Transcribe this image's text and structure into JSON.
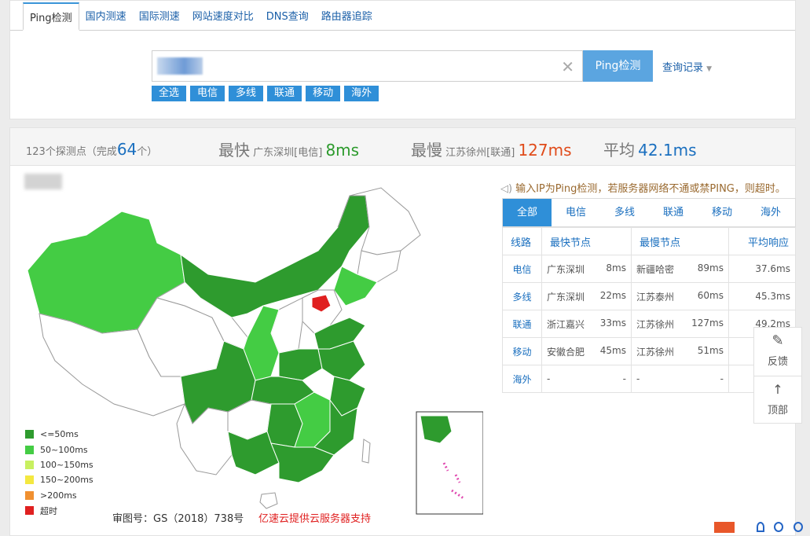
{
  "nav": {
    "tabs": [
      "Ping检测",
      "国内测速",
      "国际测速",
      "网站速度对比",
      "DNS查询",
      "路由器追踪"
    ],
    "active": 0
  },
  "search": {
    "ping_button": "Ping检测",
    "history": "查询记录",
    "chips": [
      "全选",
      "电信",
      "多线",
      "联通",
      "移动",
      "海外"
    ]
  },
  "summary": {
    "probes_prefix": "123个探测点（完成",
    "done": "64",
    "probes_suffix": "个）",
    "fastest_label": "最快",
    "fastest_node": "广东深圳[电信]",
    "fastest_value": "8ms",
    "slowest_label": "最慢",
    "slowest_node": "江苏徐州[联通]",
    "slowest_value": "127ms",
    "avg_label": "平均",
    "avg_value": "42.1ms"
  },
  "notice": "输入IP为Ping检测，若服务器网络不通或禁PING，则超时。",
  "results": {
    "tabs": [
      "全部",
      "电信",
      "多线",
      "联通",
      "移动",
      "海外"
    ],
    "active": 0,
    "headers": [
      "线路",
      "最快节点",
      "最慢节点",
      "平均响应"
    ],
    "rows": [
      {
        "line": "电信",
        "fast_node": "广东深圳",
        "fast_ms": "8ms",
        "slow_node": "新疆哈密",
        "slow_ms": "89ms",
        "avg": "37.6ms"
      },
      {
        "line": "多线",
        "fast_node": "广东深圳",
        "fast_ms": "22ms",
        "slow_node": "江苏泰州",
        "slow_ms": "60ms",
        "avg": "45.3ms"
      },
      {
        "line": "联通",
        "fast_node": "浙江嘉兴",
        "fast_ms": "33ms",
        "slow_node": "江苏徐州",
        "slow_ms": "127ms",
        "avg": "49.2ms"
      },
      {
        "line": "移动",
        "fast_node": "安徽合肥",
        "fast_ms": "45ms",
        "slow_node": "江苏徐州",
        "slow_ms": "51ms",
        "avg": ""
      },
      {
        "line": "海外",
        "fast_node": "-",
        "fast_ms": "-",
        "slow_node": "-",
        "slow_ms": "-",
        "avg": ""
      }
    ]
  },
  "legend": [
    {
      "label": "<=50ms",
      "color": "#2e9b2e"
    },
    {
      "label": "50~100ms",
      "color": "#44cc44"
    },
    {
      "label": "100~150ms",
      "color": "#c8f060"
    },
    {
      "label": "150~200ms",
      "color": "#f4e840"
    },
    {
      "label": ">200ms",
      "color": "#f09030"
    },
    {
      "label": "超时",
      "color": "#e02020"
    }
  ],
  "map_footer": {
    "approval": "审图号：GS（2018）738号",
    "sponsor": "亿速云提供云服务器支持"
  },
  "float": {
    "feedback": "反馈",
    "top": "顶部"
  }
}
